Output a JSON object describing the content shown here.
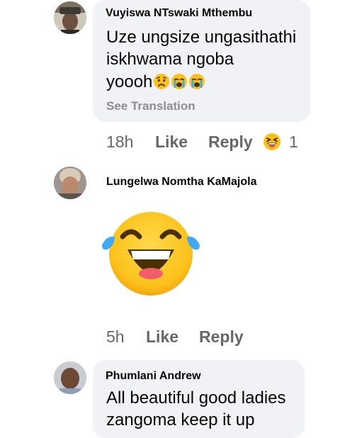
{
  "comments": [
    {
      "author": "Vuyiswa NTswaki Mthembu",
      "line1": "Uze ungsize ungasithathi",
      "line2": "iskhwama ngoba",
      "line3": "yoooh",
      "inline_emojis": [
        "sad-face-emoji",
        "crying-face-emoji",
        "crying-face-emoji"
      ],
      "see_translation": "See Translation",
      "time": "18h",
      "like": "Like",
      "reply": "Reply",
      "reaction_emoji": "laughing-squint-emoji",
      "reaction_count": "1"
    },
    {
      "author": "Lungelwa Nomtha KaMajola",
      "sticker": "laughing-tears-emoji",
      "time": "5h",
      "like": "Like",
      "reply": "Reply"
    },
    {
      "author": "Phumlani Andrew",
      "line1": "All beautiful good ladies",
      "line2": "zangoma keep it up"
    }
  ],
  "colors": {
    "bubble": "#f0f2f5",
    "meta": "#65676b",
    "text": "#050505",
    "emoji_yellow": "#fcc21b",
    "tear_blue": "#3fa9f5"
  }
}
